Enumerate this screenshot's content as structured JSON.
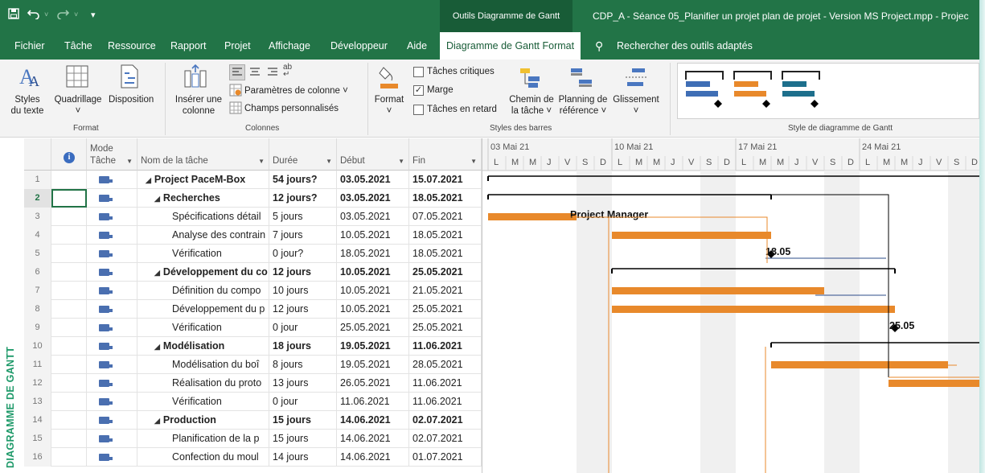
{
  "titlebar": {
    "quick_access": [
      "save-icon",
      "undo-icon",
      "redo-icon",
      "customize-icon"
    ],
    "context_tab": "Outils Diagramme de Gantt",
    "document_title": "CDP_A - Séance 05_Planifier un projet plan de projet - Version MS Project.mpp  -  Projec"
  },
  "menu": {
    "items": [
      "Fichier",
      "Tâche",
      "Ressource",
      "Rapport",
      "Projet",
      "Affichage",
      "Développeur",
      "Aide",
      "Diagramme de Gantt Format"
    ],
    "search": "Rechercher des outils adaptés"
  },
  "ribbon": {
    "format_group": {
      "label": "Format",
      "text_styles": [
        "Styles",
        "du texte"
      ],
      "gridlines": [
        "Quadrillage",
        "˅"
      ],
      "layout": "Disposition"
    },
    "columns_group": {
      "label": "Colonnes",
      "insert_column": [
        "Insérer une",
        "colonne"
      ],
      "column_settings": "Paramètres de colonne ˅",
      "custom_fields": "Champs personnalisés"
    },
    "bar_styles_group": {
      "label": "Styles des barres",
      "format": [
        "Format",
        "˅"
      ],
      "critical_tasks": "Tâches critiques",
      "critical_tasks_checked": false,
      "slack": "Marge",
      "slack_checked": true,
      "late_tasks": "Tâches en retard",
      "late_tasks_checked": false,
      "task_path": [
        "Chemin de",
        "la tâche ˅"
      ],
      "baseline": [
        "Planning de",
        "référence ˅"
      ],
      "slippage": [
        "Glissement",
        "˅"
      ]
    },
    "gantt_style_group": {
      "label": "Style de diagramme de Gantt",
      "style_colors": [
        "#3f6eb5",
        "#e8892b",
        "#1d6f8c"
      ]
    }
  },
  "side_label": "DIAGRAMME DE GANTT",
  "table": {
    "headers": {
      "info": "i",
      "mode": [
        "Mode",
        "Tâche"
      ],
      "name": "Nom de la tâche",
      "duration": "Durée",
      "start": "Début",
      "finish": "Fin"
    },
    "rows": [
      {
        "n": "1",
        "name": "Project PaceM-Box",
        "duration": "54 jours?",
        "start": "03.05.2021",
        "finish": "15.07.2021",
        "level": 0,
        "summary": true
      },
      {
        "n": "2",
        "name": "Recherches",
        "duration": "12 jours?",
        "start": "03.05.2021",
        "finish": "18.05.2021",
        "level": 1,
        "summary": true
      },
      {
        "n": "3",
        "name": "Spécifications détail",
        "duration": "5 jours",
        "start": "03.05.2021",
        "finish": "07.05.2021",
        "level": 2,
        "summary": false
      },
      {
        "n": "4",
        "name": "Analyse des contrain",
        "duration": "7 jours",
        "start": "10.05.2021",
        "finish": "18.05.2021",
        "level": 2,
        "summary": false
      },
      {
        "n": "5",
        "name": "Vérification",
        "duration": "0 jour?",
        "start": "18.05.2021",
        "finish": "18.05.2021",
        "level": 2,
        "summary": false
      },
      {
        "n": "6",
        "name": "Développement du co",
        "duration": "12 jours",
        "start": "10.05.2021",
        "finish": "25.05.2021",
        "level": 1,
        "summary": true
      },
      {
        "n": "7",
        "name": "Définition du compo",
        "duration": "10 jours",
        "start": "10.05.2021",
        "finish": "21.05.2021",
        "level": 2,
        "summary": false
      },
      {
        "n": "8",
        "name": "Développement du p",
        "duration": "12 jours",
        "start": "10.05.2021",
        "finish": "25.05.2021",
        "level": 2,
        "summary": false
      },
      {
        "n": "9",
        "name": "Vérification",
        "duration": "0 jour",
        "start": "25.05.2021",
        "finish": "25.05.2021",
        "level": 2,
        "summary": false
      },
      {
        "n": "10",
        "name": "Modélisation",
        "duration": "18 jours",
        "start": "19.05.2021",
        "finish": "11.06.2021",
        "level": 1,
        "summary": true
      },
      {
        "n": "11",
        "name": "Modélisation du boî",
        "duration": "8 jours",
        "start": "19.05.2021",
        "finish": "28.05.2021",
        "level": 2,
        "summary": false
      },
      {
        "n": "12",
        "name": "Réalisation du proto",
        "duration": "13 jours",
        "start": "26.05.2021",
        "finish": "11.06.2021",
        "level": 2,
        "summary": false
      },
      {
        "n": "13",
        "name": "Vérification",
        "duration": "0 jour",
        "start": "11.06.2021",
        "finish": "11.06.2021",
        "level": 2,
        "summary": false
      },
      {
        "n": "14",
        "name": "Production",
        "duration": "15 jours",
        "start": "14.06.2021",
        "finish": "02.07.2021",
        "level": 1,
        "summary": true
      },
      {
        "n": "15",
        "name": "Planification de la p",
        "duration": "15 jours",
        "start": "14.06.2021",
        "finish": "02.07.2021",
        "level": 2,
        "summary": false
      },
      {
        "n": "16",
        "name": "Confection du moul",
        "duration": "14 jours",
        "start": "14.06.2021",
        "finish": "01.07.2021",
        "level": 2,
        "summary": false
      }
    ],
    "selected_row": "2"
  },
  "gantt": {
    "weeks": [
      "03 Mai 21",
      "10 Mai 21",
      "17 Mai 21",
      "24 Mai 21"
    ],
    "day_letters": [
      "L",
      "M",
      "M",
      "J",
      "V",
      "S",
      "D"
    ],
    "bar_labels": {
      "row3_resource": "Project Manager",
      "row5_milestone": "18.05",
      "row9_milestone": "25.05"
    },
    "colors": {
      "task_bar": "#e8892b",
      "summary_bar": "#000000",
      "slack_line": "#2e4c8a",
      "weekend_shade": "#f0f0f0"
    }
  }
}
